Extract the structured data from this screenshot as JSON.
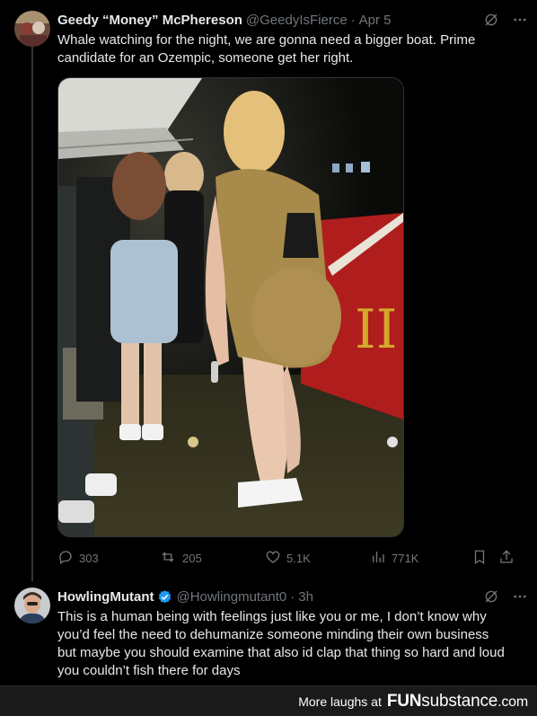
{
  "tweet1": {
    "display_name": "Geedy “Money” McPhereson",
    "handle": "@GeedyIsFierce",
    "separator": "·",
    "time": "Apr 5",
    "text": "Whale watching for the night, we are gonna need a bigger boat. Prime\ncandidate for an Ozempic, someone get her right.",
    "media_sign": "II",
    "stats": {
      "replies": "303",
      "reposts": "205",
      "likes": "5.1K",
      "views": "771K"
    }
  },
  "tweet2": {
    "display_name": "HowlingMutant",
    "handle": "@Howlingmutant0",
    "separator": "·",
    "time": "3h",
    "text": "This is a human being with feelings just like you or me, I don’t know why\nyou’d feel the need to dehumanize someone minding their own business\nbut maybe you should examine that also id clap that thing so hard and loud\nyou couldn’t fish there for days"
  },
  "footer": {
    "more_label": "More laughs at",
    "brand_fun": "FUN",
    "brand_sub": "substance",
    "brand_tld": ".com"
  },
  "icons": {
    "more": "more-icon",
    "grok": "grok-icon",
    "reply": "reply-icon",
    "repost": "repost-icon",
    "like": "like-icon",
    "views": "views-icon",
    "bookmark": "bookmark-icon",
    "share": "share-icon",
    "verified": "verified-badge-icon"
  },
  "colors": {
    "background": "#000000",
    "text": "#e7e9ea",
    "muted": "#71767b",
    "verified": "#1d9bf0",
    "footer_bg": "#1a1a1a"
  }
}
